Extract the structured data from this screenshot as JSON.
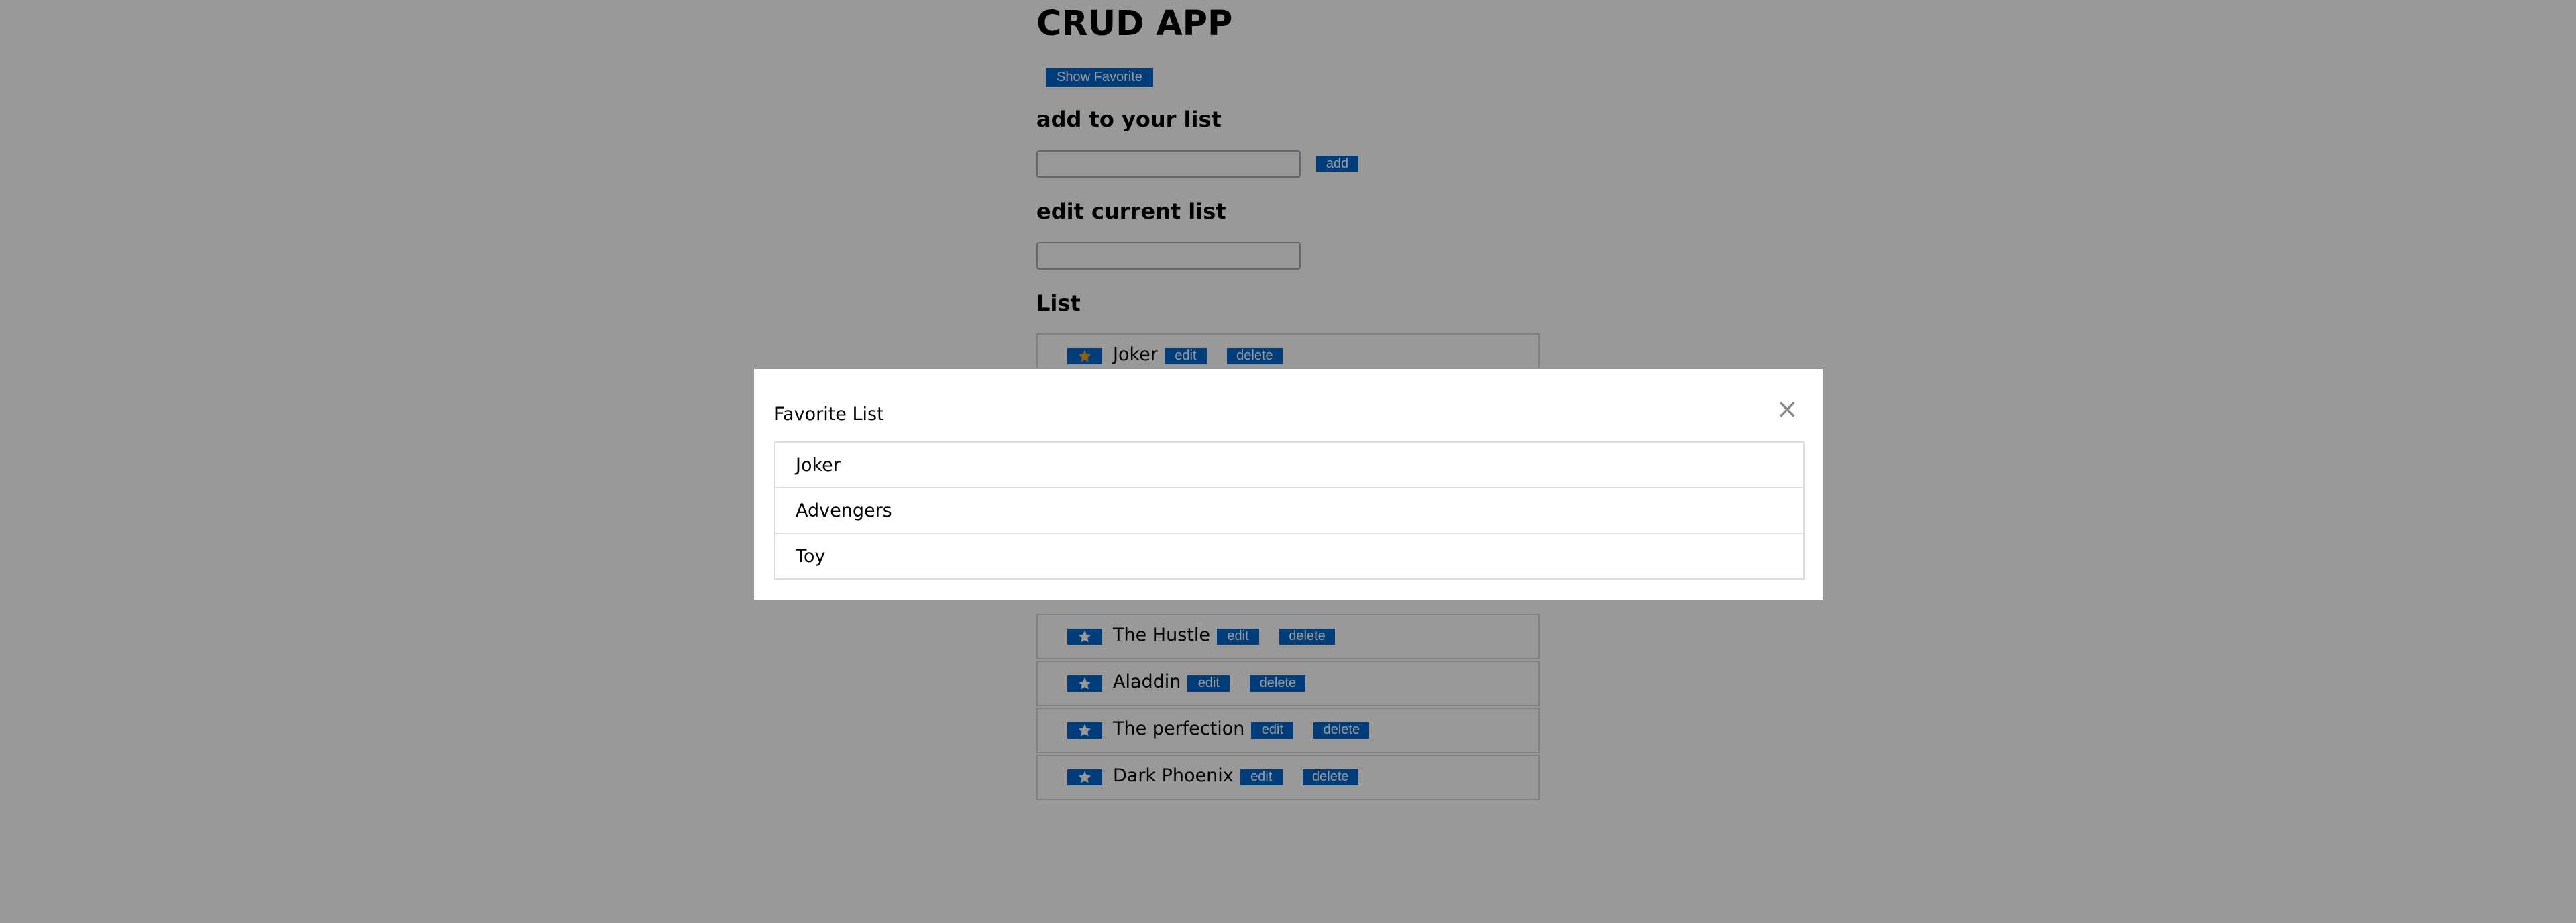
{
  "app": {
    "title": "CRUD APP",
    "show_favorite_label": "Show Favorite"
  },
  "add_section": {
    "heading": "add to your list",
    "input_value": "",
    "add_label": "add"
  },
  "edit_section": {
    "heading": "edit current list",
    "input_value": ""
  },
  "list": {
    "heading": "List",
    "edit_label": "edit",
    "delete_label": "delete",
    "items": [
      {
        "title": "Joker",
        "favorite": true
      },
      {
        "title": "Advengers",
        "favorite": true
      },
      {
        "title": "Toy",
        "favorite": true
      },
      {
        "title": "",
        "favorite": false
      },
      {
        "title": "The Hustle",
        "favorite": false
      },
      {
        "title": "Aladdin",
        "favorite": false
      },
      {
        "title": "The perfection",
        "favorite": false
      },
      {
        "title": "Dark Phoenix",
        "favorite": false
      }
    ]
  },
  "modal": {
    "title": "Favorite List",
    "close_symbol": "×",
    "items": [
      "Joker",
      "Advengers",
      "Toy"
    ]
  },
  "colors": {
    "button_blue": "#0066cc",
    "favorite_star": "#f0a020",
    "plain_star": "#ffffff",
    "overlay": "rgba(0,0,0,0.4)"
  },
  "icons": {
    "star": "star-icon",
    "close": "close-icon"
  }
}
